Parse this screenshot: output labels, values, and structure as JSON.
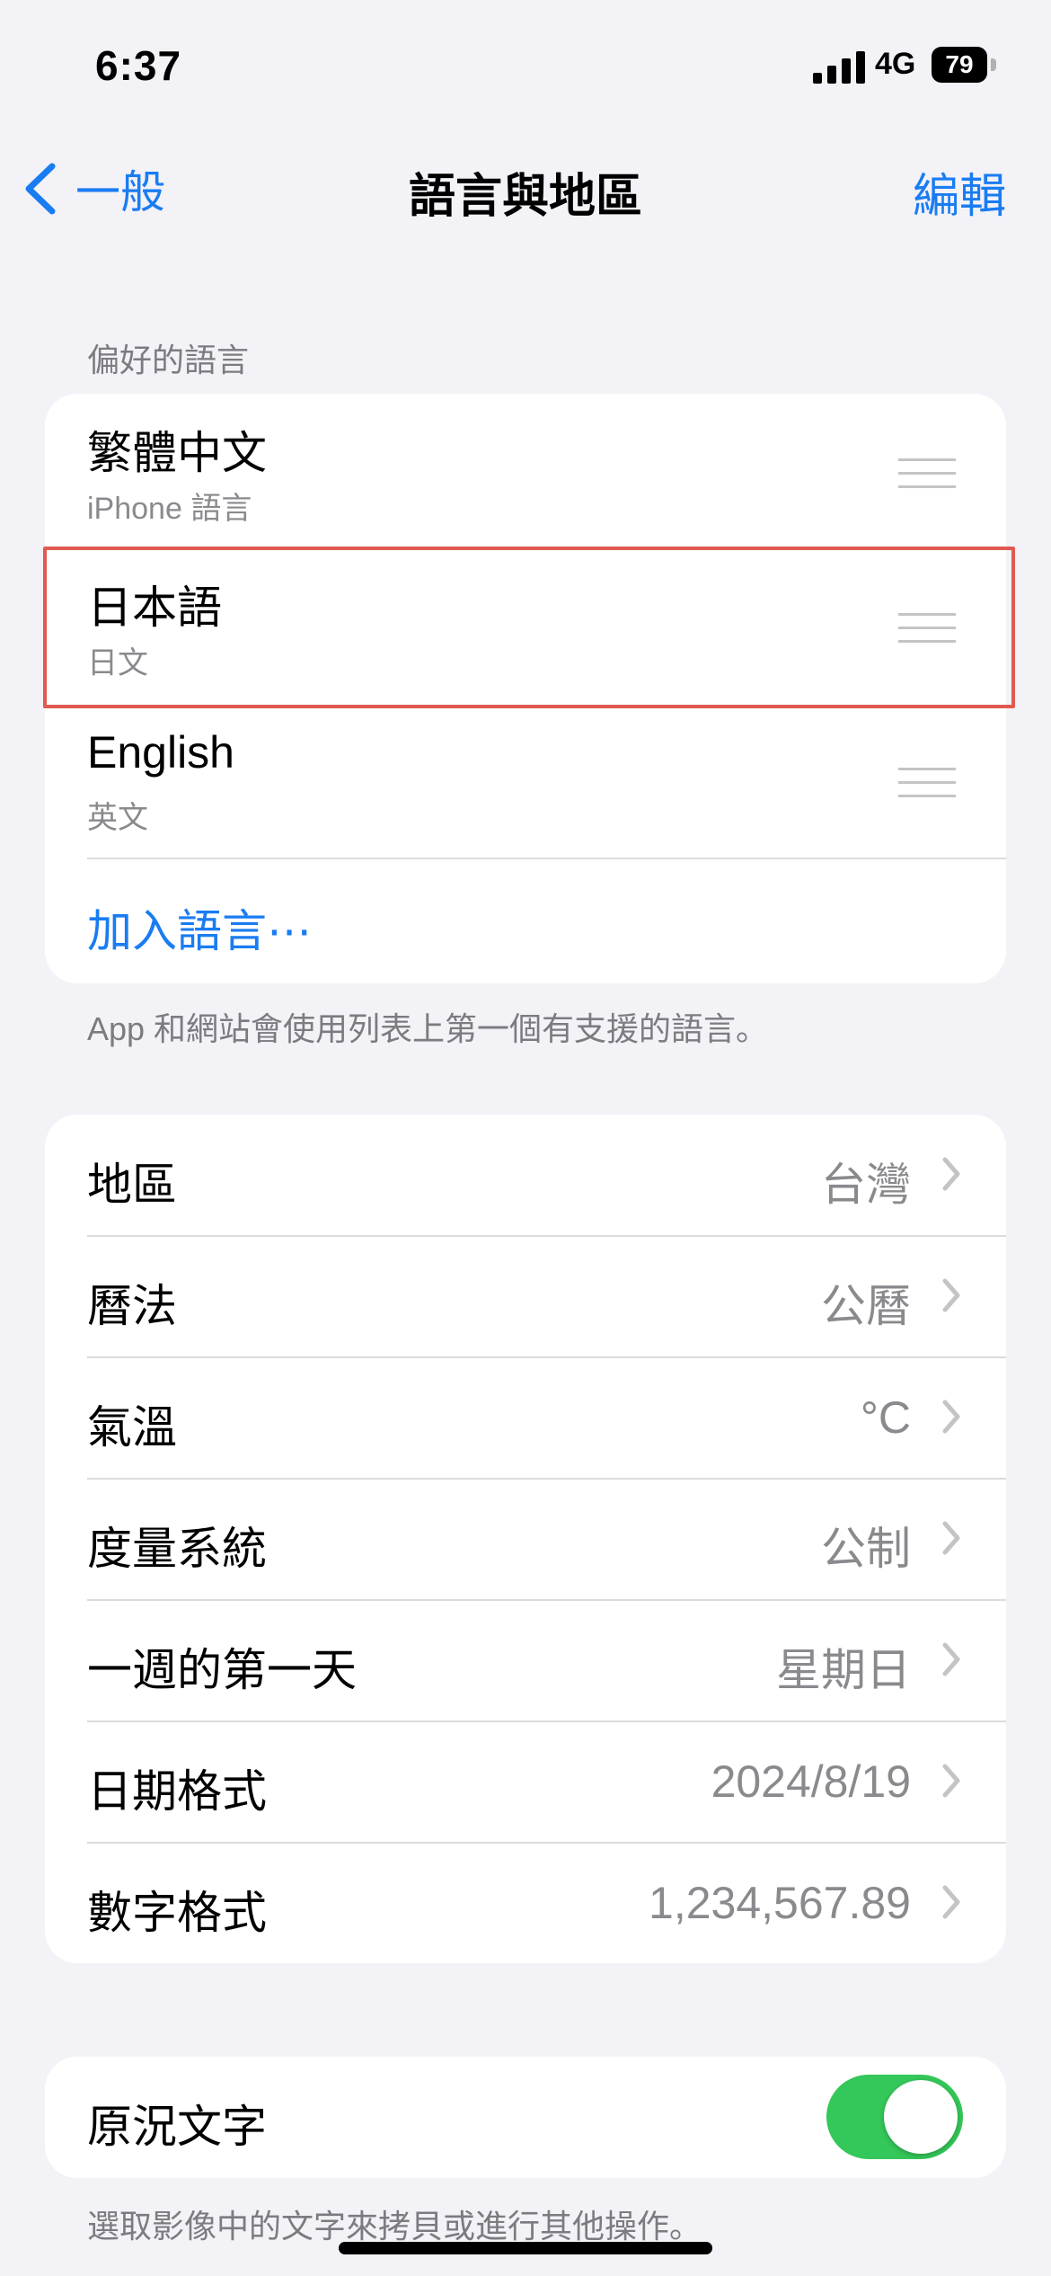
{
  "status": {
    "time": "6:37",
    "network": "4G",
    "battery": "79"
  },
  "nav": {
    "back_label": "一般",
    "title": "語言與地區",
    "edit_label": "編輯"
  },
  "languages": {
    "header": "偏好的語言",
    "items": [
      {
        "name": "繁體中文",
        "sub": "iPhone 語言"
      },
      {
        "name": "日本語",
        "sub": "日文"
      },
      {
        "name": "English",
        "sub": "英文"
      }
    ],
    "add_label": "加入語言⋯",
    "footer": "App 和網站會使用列表上第一個有支援的語言。"
  },
  "region": {
    "items": [
      {
        "label": "地區",
        "value": "台灣"
      },
      {
        "label": "曆法",
        "value": "公曆"
      },
      {
        "label": "氣溫",
        "value": "°C"
      },
      {
        "label": "度量系統",
        "value": "公制"
      },
      {
        "label": "一週的第一天",
        "value": "星期日"
      },
      {
        "label": "日期格式",
        "value": "2024/8/19"
      },
      {
        "label": "數字格式",
        "value": "1,234,567.89"
      }
    ]
  },
  "live_text": {
    "label": "原況文字",
    "enabled": true,
    "footer": "選取影像中的文字來拷貝或進行其他操作。"
  },
  "colors": {
    "accent": "#1a7cf2",
    "toggle_on": "#34c759",
    "highlight": "#e05a50"
  }
}
